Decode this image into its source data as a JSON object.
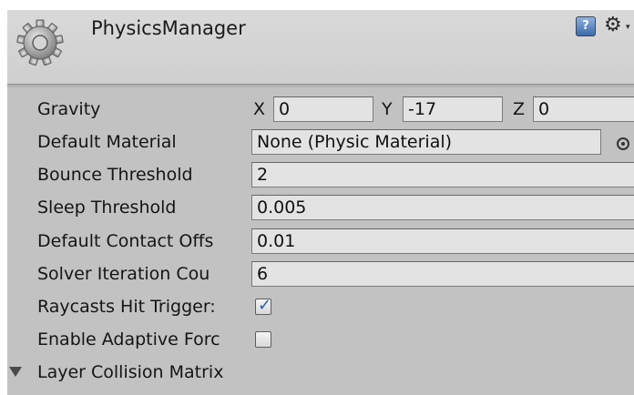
{
  "header": {
    "title": "PhysicsManager",
    "icons": {
      "component": "gear-icon",
      "help": "help-book-icon",
      "settings": "settings-cog-icon"
    },
    "help_glyph": "?",
    "cog_glyph": "⚙",
    "cog_caret": "▾"
  },
  "fields": {
    "gravity": {
      "label": "Gravity",
      "x_label": "X",
      "x": "0",
      "y_label": "Y",
      "y": "-17",
      "z_label": "Z",
      "z": "0"
    },
    "default_material": {
      "label": "Default Material",
      "value": "None (Physic Material)"
    },
    "bounce_threshold": {
      "label": "Bounce Threshold",
      "value": "2"
    },
    "sleep_threshold": {
      "label": "Sleep Threshold",
      "value": "0.005"
    },
    "default_contact_offset": {
      "label": "Default Contact Offs",
      "value": "0.01"
    },
    "solver_iteration_count": {
      "label": "Solver Iteration Cou",
      "value": "6"
    },
    "raycasts_hit_triggers": {
      "label": "Raycasts Hit Trigger:",
      "checked": true,
      "mark": "✓"
    },
    "enable_adaptive_force": {
      "label": "Enable Adaptive Forc",
      "checked": false
    }
  },
  "foldout": {
    "label": "Layer Collision Matrix",
    "expanded": true
  }
}
